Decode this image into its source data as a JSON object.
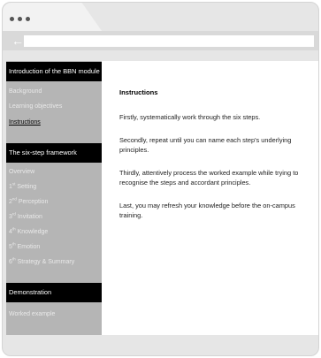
{
  "browser": {
    "back_glyph": "←",
    "url": ""
  },
  "sidebar": {
    "sections": [
      {
        "title": "Introduction of the BBN module",
        "items": [
          {
            "label": "Background",
            "active": false
          },
          {
            "label": "Learning objectives",
            "active": false
          },
          {
            "label": "Instructions",
            "active": true
          }
        ]
      },
      {
        "title": "The six-step framework",
        "items": [
          {
            "label": "Overview",
            "active": false
          },
          {
            "num": "1",
            "sup": "st",
            "label": " Setting",
            "active": false
          },
          {
            "num": "2",
            "sup": "nd",
            "label": " Perception",
            "active": false
          },
          {
            "num": "3",
            "sup": "rd",
            "label": " Invitation",
            "active": false
          },
          {
            "num": "4",
            "sup": "th",
            "label": " Knowledge",
            "active": false
          },
          {
            "num": "5",
            "sup": "th",
            "label": " Emotion",
            "active": false
          },
          {
            "num": "6",
            "sup": "th",
            "label": " Strategy & Summary",
            "active": false
          }
        ]
      },
      {
        "title": "Demonstration",
        "items": [
          {
            "label": "Worked example",
            "active": false
          }
        ]
      }
    ]
  },
  "main": {
    "heading": "Instructions",
    "paragraphs": [
      "Firstly, systematically work through the six steps.",
      "Secondly, repeat until you can name each step's underlying principles.",
      "Thirdly, attentively process the worked example while trying to recognise the steps and accordant principles.",
      "Last, you may refresh your knowledge before the on-campus training."
    ]
  }
}
